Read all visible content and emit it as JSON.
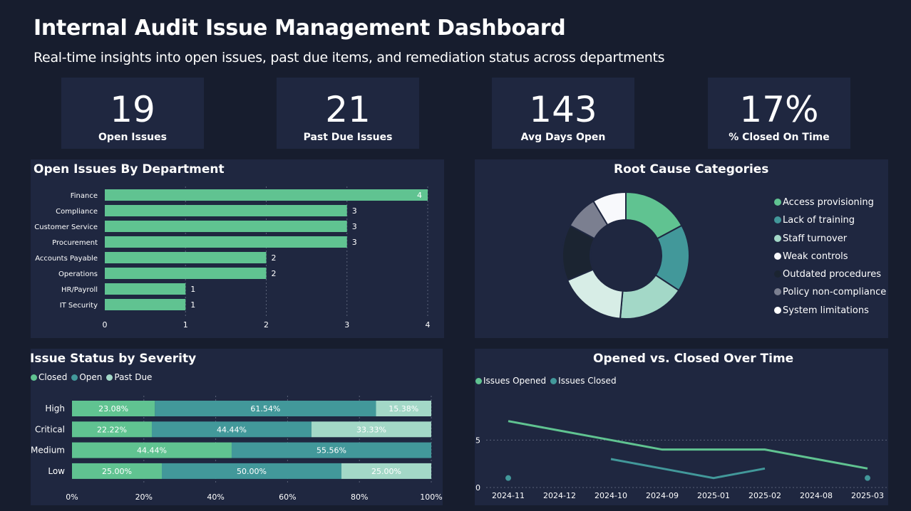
{
  "header": {
    "title": "Internal Audit Issue Management Dashboard",
    "subtitle": "Real-time insights into open issues, past due items, and remediation status across departments"
  },
  "kpis": [
    {
      "value": "19",
      "label": "Open Issues"
    },
    {
      "value": "21",
      "label": "Past Due Issues"
    },
    {
      "value": "143",
      "label": "Avg Days Open"
    },
    {
      "value": "17%",
      "label": "% Closed On Time"
    }
  ],
  "colors": {
    "background": "#171d2e",
    "panel": "#1f2740",
    "green": "#60c391",
    "teal": "#42989a",
    "mint": "#a3d8c7",
    "white": "#f8f9fc",
    "charcoal": "#1b2431",
    "gray": "#7b7f90",
    "pale": "#d7ede6"
  },
  "panels": {
    "dept_title": "Open Issues By Department",
    "root_title": "Root Cause Categories",
    "severity_title": "Issue Status by Severity",
    "time_title": "Opened vs. Closed Over Time"
  },
  "chart_data": [
    {
      "type": "bar",
      "orientation": "horizontal",
      "title": "Open Issues By Department",
      "categories": [
        "Finance",
        "Compliance",
        "Customer Service",
        "Procurement",
        "Accounts Payable",
        "Operations",
        "HR/Payroll",
        "IT Security"
      ],
      "values": [
        4,
        3,
        3,
        3,
        2,
        2,
        1,
        1
      ],
      "xlim": [
        0,
        4
      ],
      "xticks": [
        0,
        1,
        2,
        3,
        4
      ],
      "grid": true,
      "color": "#60c391"
    },
    {
      "type": "pie",
      "donut": true,
      "title": "Root Cause Categories",
      "legend_position": "right",
      "slices": [
        {
          "label": "Access provisioning",
          "value": 3,
          "color": "#60c391"
        },
        {
          "label": "Lack of training",
          "value": 3,
          "color": "#42989a"
        },
        {
          "label": "Staff turnover",
          "value": 3,
          "color": "#a3d8c7"
        },
        {
          "label": "Weak controls",
          "value": 3,
          "color": "#d7ede6"
        },
        {
          "label": "Outdated procedures",
          "value": 2.5,
          "color": "#1b2431"
        },
        {
          "label": "Policy non-compliance",
          "value": 1.5,
          "color": "#7b7f90"
        },
        {
          "label": "System limitations",
          "value": 1.5,
          "color": "#f8f9fc"
        }
      ],
      "legend_colors": [
        "#60c391",
        "#42989a",
        "#a3d8c7",
        "#f8f9fc",
        "#1b2431",
        "#7b7f90",
        "#ffffff"
      ]
    },
    {
      "type": "bar",
      "stacked": "percent",
      "orientation": "horizontal",
      "title": "Issue Status by Severity",
      "legend_position": "top-left",
      "categories": [
        "High",
        "Critical",
        "Medium",
        "Low"
      ],
      "series": [
        {
          "name": "Closed",
          "color": "#60c391",
          "values": [
            23.08,
            22.22,
            44.44,
            25.0
          ],
          "labels": [
            "23.08%",
            "22.22%",
            "44.44%",
            "25.00%"
          ]
        },
        {
          "name": "Open",
          "color": "#42989a",
          "values": [
            61.54,
            44.44,
            55.56,
            50.0
          ],
          "labels": [
            "61.54%",
            "44.44%",
            "55.56%",
            "50.00%"
          ]
        },
        {
          "name": "Past Due",
          "color": "#a3d8c7",
          "values": [
            15.38,
            33.33,
            0,
            25.0
          ],
          "labels": [
            "15.38%",
            "33.33%",
            "",
            "25.00%"
          ]
        }
      ],
      "xticks": [
        "0%",
        "20%",
        "40%",
        "60%",
        "80%",
        "100%"
      ]
    },
    {
      "type": "line",
      "title": "Opened vs. Closed Over Time",
      "legend_position": "top-left",
      "categories": [
        "2024-11",
        "2024-12",
        "2024-10",
        "2024-09",
        "2025-01",
        "2025-02",
        "2024-08",
        "2025-03"
      ],
      "series": [
        {
          "name": "Issues Opened",
          "color": "#60c391",
          "values": [
            7,
            6,
            5,
            4,
            4,
            4,
            3,
            2
          ]
        },
        {
          "name": "Issues Closed",
          "color": "#42989a",
          "values": [
            1,
            null,
            3,
            2,
            1,
            2,
            null,
            1
          ]
        }
      ],
      "ylim": [
        0,
        9
      ],
      "yticks": [
        0,
        5
      ],
      "grid": true
    }
  ]
}
